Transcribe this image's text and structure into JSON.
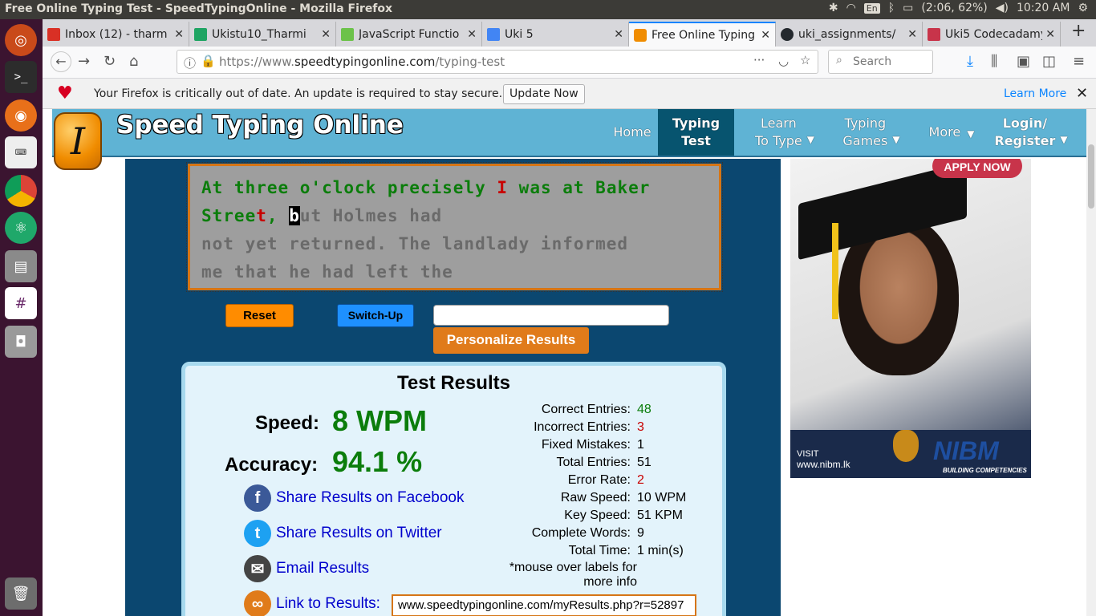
{
  "os": {
    "window_title": "Free Online Typing Test - SpeedTypingOnline - Mozilla Firefox",
    "keyboard_layout": "En",
    "battery": "(2:06, 62%)",
    "clock": "10:20 AM"
  },
  "browser": {
    "tabs": [
      {
        "label": "Inbox (12) - tharm",
        "color": "#d93025"
      },
      {
        "label": "Ukistu10_Tharmi",
        "color": "#1fa463"
      },
      {
        "label": "JavaScript Functio",
        "color": "#6cc24a"
      },
      {
        "label": "Uki 5",
        "color": "#4285f4"
      },
      {
        "label": "Free Online Typing",
        "color": "#f08c00"
      },
      {
        "label": "uki_assignments/",
        "color": "#24292e"
      },
      {
        "label": "Uki5 Codecadamy",
        "color": "#c8344a"
      }
    ],
    "url_prefix": "https://www.",
    "url_domain": "speedtypingonline.com",
    "url_path": "/typing-test",
    "search_placeholder": "Search",
    "notification": {
      "message": "Your Firefox is critically out of date. An update is required to stay secure.",
      "update_button": "Update Now",
      "learn_more": "Learn More"
    }
  },
  "site": {
    "brand": "Speed Typing Online",
    "logo_letter": "I",
    "nav": {
      "home": "Home",
      "typing_test_1": "Typing",
      "typing_test_2": "Test",
      "learn_1": "Learn",
      "learn_2": "To Type",
      "games_1": "Typing",
      "games_2": "Games",
      "more": "More",
      "login_1": "Login/",
      "login_2": "Register"
    }
  },
  "typing": {
    "line1_correct": "At three o'clock precisely ",
    "line1_error": "I",
    "line1_correct2": " was at Baker",
    "line2_correct": "Stree",
    "line2_error": "t",
    "line2_correct2": ",",
    "line2_space": " ",
    "cursor_char": "b",
    "line2_rest": "ut Holmes had",
    "line3": "not yet returned. The landlady informed",
    "line4": "me that he had left the"
  },
  "controls": {
    "reset": "Reset",
    "switch_up": "Switch-Up",
    "personalize": "Personalize Results"
  },
  "results": {
    "title": "Test Results",
    "speed_label": "Speed:",
    "speed_value": "8 WPM",
    "accuracy_label": "Accuracy:",
    "accuracy_value": "94.1 %",
    "share_facebook": "Share Results on Facebook",
    "share_twitter": "Share Results on Twitter",
    "email": "Email Results",
    "link_label": "Link to Results:",
    "link_value": "www.speedtypingonline.com/myResults.php?r=52897",
    "stats": [
      {
        "label": "Correct Entries:",
        "value": "48",
        "style": "good"
      },
      {
        "label": "Incorrect Entries:",
        "value": "3",
        "style": "bad"
      },
      {
        "label": "Fixed Mistakes:",
        "value": "1",
        "style": "normal"
      },
      {
        "label": "Total Entries:",
        "value": "51",
        "style": "normal"
      },
      {
        "label": "Error Rate:",
        "value": "2",
        "style": "bad"
      },
      {
        "label": "Raw Speed:",
        "value": "10 WPM",
        "style": "normal"
      },
      {
        "label": "Key Speed:",
        "value": "51 KPM",
        "style": "normal"
      },
      {
        "label": "Complete Words:",
        "value": "9",
        "style": "normal"
      },
      {
        "label": "Total Time:",
        "value": "1 min(s)",
        "style": "normal"
      }
    ],
    "note_1": "*mouse over labels for",
    "note_2": "more info"
  },
  "ad": {
    "apply": "APPLY NOW",
    "visit_1": "VISIT",
    "visit_2": "www.nibm.lk",
    "brand": "NIBM",
    "tagline": "BUILDING COMPETENCIES"
  }
}
